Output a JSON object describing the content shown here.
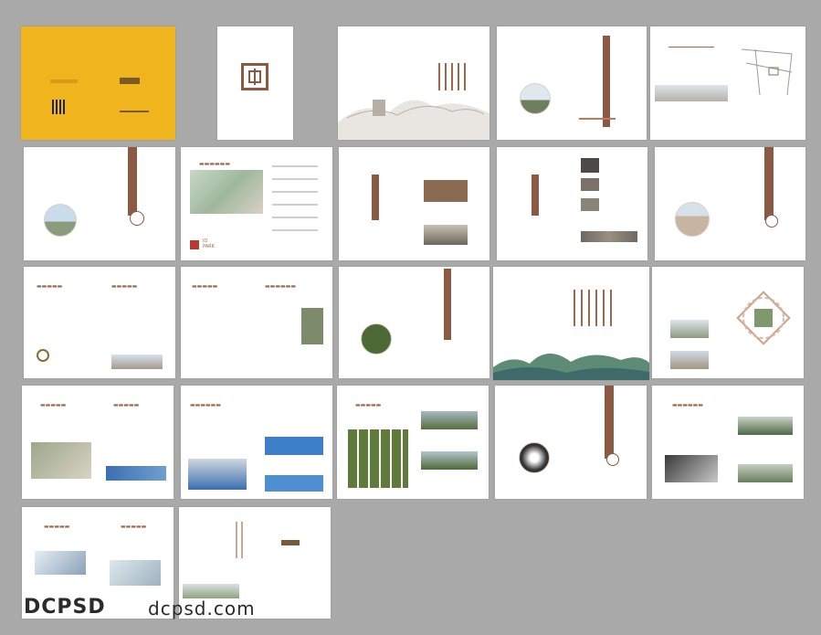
{
  "brand_lines": {
    "park_top": "IO",
    "park_bottom": "PARK"
  },
  "watermark": {
    "left": "DCPSD",
    "right": "dcpsd.com"
  },
  "colors": {
    "background": "#a9a9a9",
    "cover": "#f0b41c",
    "accent": "#8a5a44",
    "text_tan": "#9a6a4e"
  }
}
